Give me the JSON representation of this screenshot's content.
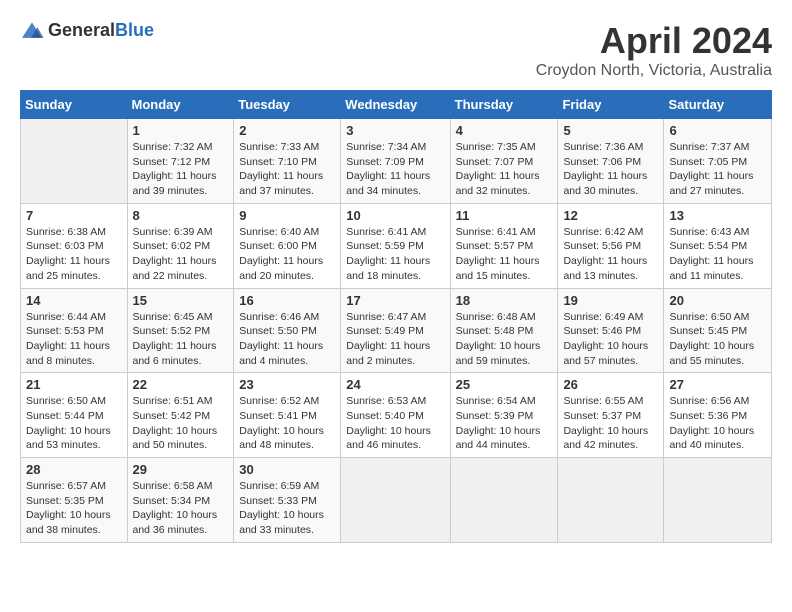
{
  "header": {
    "logo_general": "General",
    "logo_blue": "Blue",
    "month": "April 2024",
    "location": "Croydon North, Victoria, Australia"
  },
  "weekdays": [
    "Sunday",
    "Monday",
    "Tuesday",
    "Wednesday",
    "Thursday",
    "Friday",
    "Saturday"
  ],
  "weeks": [
    [
      {
        "day": "",
        "info": ""
      },
      {
        "day": "1",
        "info": "Sunrise: 7:32 AM\nSunset: 7:12 PM\nDaylight: 11 hours\nand 39 minutes."
      },
      {
        "day": "2",
        "info": "Sunrise: 7:33 AM\nSunset: 7:10 PM\nDaylight: 11 hours\nand 37 minutes."
      },
      {
        "day": "3",
        "info": "Sunrise: 7:34 AM\nSunset: 7:09 PM\nDaylight: 11 hours\nand 34 minutes."
      },
      {
        "day": "4",
        "info": "Sunrise: 7:35 AM\nSunset: 7:07 PM\nDaylight: 11 hours\nand 32 minutes."
      },
      {
        "day": "5",
        "info": "Sunrise: 7:36 AM\nSunset: 7:06 PM\nDaylight: 11 hours\nand 30 minutes."
      },
      {
        "day": "6",
        "info": "Sunrise: 7:37 AM\nSunset: 7:05 PM\nDaylight: 11 hours\nand 27 minutes."
      }
    ],
    [
      {
        "day": "7",
        "info": "Sunrise: 6:38 AM\nSunset: 6:03 PM\nDaylight: 11 hours\nand 25 minutes."
      },
      {
        "day": "8",
        "info": "Sunrise: 6:39 AM\nSunset: 6:02 PM\nDaylight: 11 hours\nand 22 minutes."
      },
      {
        "day": "9",
        "info": "Sunrise: 6:40 AM\nSunset: 6:00 PM\nDaylight: 11 hours\nand 20 minutes."
      },
      {
        "day": "10",
        "info": "Sunrise: 6:41 AM\nSunset: 5:59 PM\nDaylight: 11 hours\nand 18 minutes."
      },
      {
        "day": "11",
        "info": "Sunrise: 6:41 AM\nSunset: 5:57 PM\nDaylight: 11 hours\nand 15 minutes."
      },
      {
        "day": "12",
        "info": "Sunrise: 6:42 AM\nSunset: 5:56 PM\nDaylight: 11 hours\nand 13 minutes."
      },
      {
        "day": "13",
        "info": "Sunrise: 6:43 AM\nSunset: 5:54 PM\nDaylight: 11 hours\nand 11 minutes."
      }
    ],
    [
      {
        "day": "14",
        "info": "Sunrise: 6:44 AM\nSunset: 5:53 PM\nDaylight: 11 hours\nand 8 minutes."
      },
      {
        "day": "15",
        "info": "Sunrise: 6:45 AM\nSunset: 5:52 PM\nDaylight: 11 hours\nand 6 minutes."
      },
      {
        "day": "16",
        "info": "Sunrise: 6:46 AM\nSunset: 5:50 PM\nDaylight: 11 hours\nand 4 minutes."
      },
      {
        "day": "17",
        "info": "Sunrise: 6:47 AM\nSunset: 5:49 PM\nDaylight: 11 hours\nand 2 minutes."
      },
      {
        "day": "18",
        "info": "Sunrise: 6:48 AM\nSunset: 5:48 PM\nDaylight: 10 hours\nand 59 minutes."
      },
      {
        "day": "19",
        "info": "Sunrise: 6:49 AM\nSunset: 5:46 PM\nDaylight: 10 hours\nand 57 minutes."
      },
      {
        "day": "20",
        "info": "Sunrise: 6:50 AM\nSunset: 5:45 PM\nDaylight: 10 hours\nand 55 minutes."
      }
    ],
    [
      {
        "day": "21",
        "info": "Sunrise: 6:50 AM\nSunset: 5:44 PM\nDaylight: 10 hours\nand 53 minutes."
      },
      {
        "day": "22",
        "info": "Sunrise: 6:51 AM\nSunset: 5:42 PM\nDaylight: 10 hours\nand 50 minutes."
      },
      {
        "day": "23",
        "info": "Sunrise: 6:52 AM\nSunset: 5:41 PM\nDaylight: 10 hours\nand 48 minutes."
      },
      {
        "day": "24",
        "info": "Sunrise: 6:53 AM\nSunset: 5:40 PM\nDaylight: 10 hours\nand 46 minutes."
      },
      {
        "day": "25",
        "info": "Sunrise: 6:54 AM\nSunset: 5:39 PM\nDaylight: 10 hours\nand 44 minutes."
      },
      {
        "day": "26",
        "info": "Sunrise: 6:55 AM\nSunset: 5:37 PM\nDaylight: 10 hours\nand 42 minutes."
      },
      {
        "day": "27",
        "info": "Sunrise: 6:56 AM\nSunset: 5:36 PM\nDaylight: 10 hours\nand 40 minutes."
      }
    ],
    [
      {
        "day": "28",
        "info": "Sunrise: 6:57 AM\nSunset: 5:35 PM\nDaylight: 10 hours\nand 38 minutes."
      },
      {
        "day": "29",
        "info": "Sunrise: 6:58 AM\nSunset: 5:34 PM\nDaylight: 10 hours\nand 36 minutes."
      },
      {
        "day": "30",
        "info": "Sunrise: 6:59 AM\nSunset: 5:33 PM\nDaylight: 10 hours\nand 33 minutes."
      },
      {
        "day": "",
        "info": ""
      },
      {
        "day": "",
        "info": ""
      },
      {
        "day": "",
        "info": ""
      },
      {
        "day": "",
        "info": ""
      }
    ]
  ]
}
